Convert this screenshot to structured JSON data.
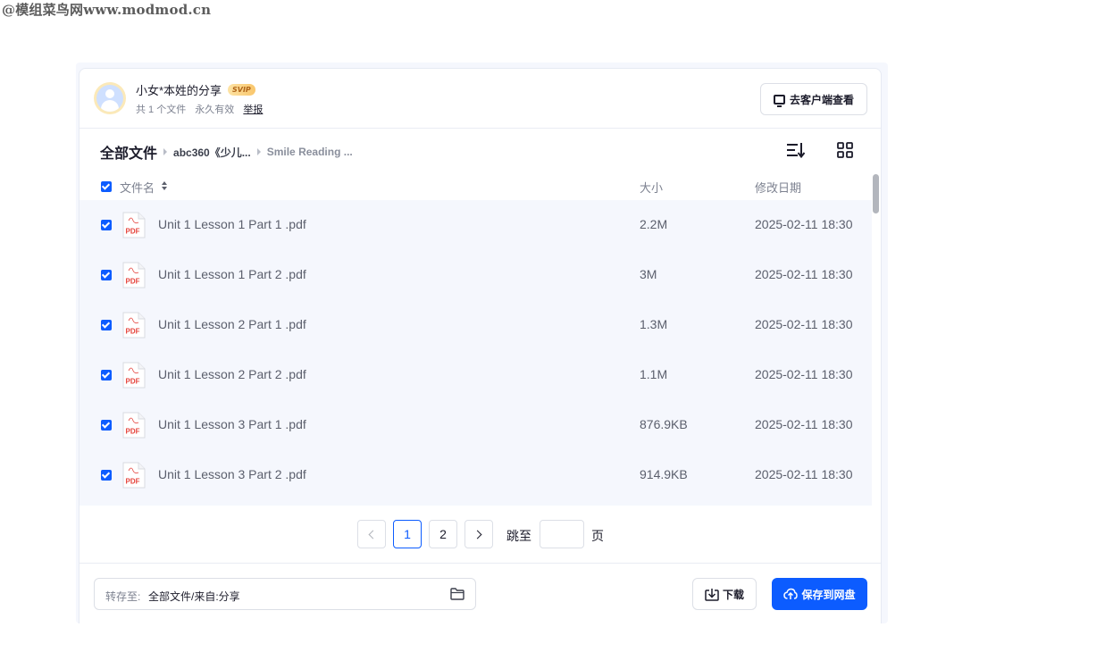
{
  "watermark": "@模组菜鸟网www.modmod.cn",
  "share": {
    "owner": "小女*本姓的分享",
    "badge": "SVIP",
    "file_count": "共 1 个文件",
    "validity": "永久有效",
    "report": "举报",
    "client_button": "去客户端查看"
  },
  "breadcrumb": {
    "root": "全部文件",
    "level1": "abc360《少儿...",
    "level2": "Smile Reading ..."
  },
  "table": {
    "col_name": "文件名",
    "col_size": "大小",
    "col_date": "修改日期",
    "rows": [
      {
        "name": "Unit 1 Lesson 1 Part 1 .pdf",
        "size": "2.2M",
        "date": "2025-02-11 18:30",
        "icon": "pdf-file-icon"
      },
      {
        "name": "Unit 1 Lesson 1 Part 2 .pdf",
        "size": "3M",
        "date": "2025-02-11 18:30",
        "icon": "pdf-file-icon"
      },
      {
        "name": "Unit 1 Lesson 2 Part 1 .pdf",
        "size": "1.3M",
        "date": "2025-02-11 18:30",
        "icon": "pdf-file-icon"
      },
      {
        "name": "Unit 1 Lesson 2 Part 2 .pdf",
        "size": "1.1M",
        "date": "2025-02-11 18:30",
        "icon": "pdf-file-icon"
      },
      {
        "name": "Unit 1 Lesson 3 Part 1 .pdf",
        "size": "876.9KB",
        "date": "2025-02-11 18:30",
        "icon": "pdf-file-icon"
      },
      {
        "name": "Unit 1 Lesson 3 Part 2 .pdf",
        "size": "914.9KB",
        "date": "2025-02-11 18:30",
        "icon": "pdf-file-icon"
      }
    ]
  },
  "pager": {
    "pages": [
      "1",
      "2"
    ],
    "current_page": "1",
    "jump_label": "跳至",
    "page_unit": "页"
  },
  "footer": {
    "saveto_label": "转存至:",
    "saveto_path": "全部文件/来自:分享",
    "download": "下载",
    "save": "保存到网盘"
  },
  "colors": {
    "accent": "#0c5cff",
    "pdf_red": "#e5413a",
    "row_bg": "#f5f7fd"
  }
}
